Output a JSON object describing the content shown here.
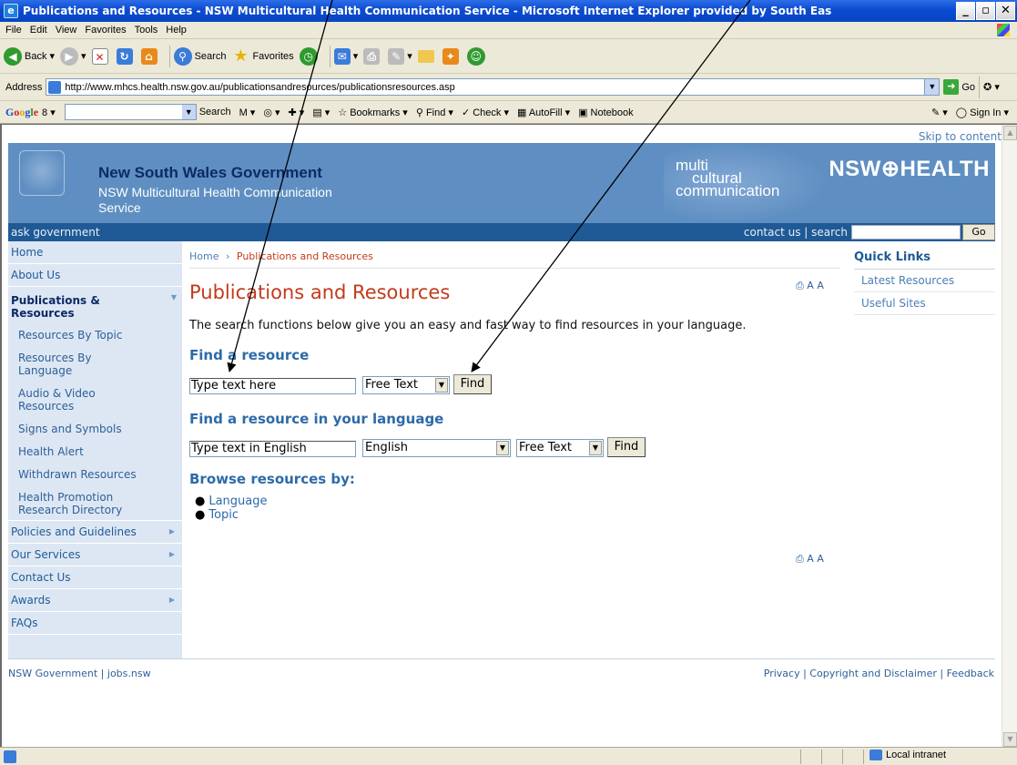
{
  "window": {
    "title": "Publications and Resources - NSW Multicultural Health Communication Service - Microsoft Internet Explorer provided by South Eas",
    "min": "_",
    "max": "▫",
    "close": "✕"
  },
  "menu": [
    "File",
    "Edit",
    "View",
    "Favorites",
    "Tools",
    "Help"
  ],
  "toolbar": {
    "back": "Back",
    "search": "Search",
    "favorites": "Favorites"
  },
  "address": {
    "label": "Address",
    "url": "http://www.mhcs.health.nsw.gov.au/publicationsandresources/publicationsresources.asp",
    "go": "Go"
  },
  "googlebar": {
    "logo": [
      "G",
      "o",
      "o",
      "g",
      "l",
      "e"
    ],
    "search": "Search",
    "bookmarks": "Bookmarks",
    "find": "Find",
    "check": "Check",
    "autofill": "AutoFill",
    "notebook": "Notebook",
    "signin": "Sign In"
  },
  "site": {
    "skip": "Skip to content",
    "gov_name": "New South Wales Government",
    "service_name": "NSW Multicultural Health Communication Service",
    "mcc": [
      "multi",
      "cultural",
      "communication"
    ],
    "nsw_health": "NSW⊕HEALTH",
    "ask": "ask government",
    "top_links": "contact us | search",
    "search_go": "Go"
  },
  "sidebar": {
    "items": [
      {
        "label": "Home",
        "arrow": ""
      },
      {
        "label": "About Us",
        "arrow": ""
      },
      {
        "label": "Publications & Resources",
        "arrow": "▼"
      },
      {
        "label": "Policies and Guidelines",
        "arrow": "▶"
      },
      {
        "label": "Our Services",
        "arrow": "▶"
      },
      {
        "label": "Contact Us",
        "arrow": ""
      },
      {
        "label": "Awards",
        "arrow": "▶"
      },
      {
        "label": "FAQs",
        "arrow": ""
      }
    ],
    "sub": [
      "Resources By Topic",
      "Resources By Language",
      "Audio & Video Resources",
      "Signs and Symbols",
      "Health Alert",
      "Withdrawn Resources",
      "Health Promotion Research Directory"
    ]
  },
  "main": {
    "breadcrumb_home": "Home",
    "breadcrumb_sep": "›",
    "breadcrumb_current": "Publications and Resources",
    "print_text": "⎙ A A",
    "title": "Publications and Resources",
    "intro": "The search functions below give you an easy and fast way to find resources in your language.",
    "find_heading": "Find a resource",
    "find_placeholder": "Type text here",
    "find_type": "Free Text",
    "find_button": "Find",
    "lang_heading": "Find a resource in your language",
    "lang_placeholder": "Type text in English",
    "lang_select": "English",
    "lang_type": "Free Text",
    "lang_button": "Find",
    "browse_heading": "Browse resources by:",
    "browse_items": [
      "Language",
      "Topic"
    ]
  },
  "quick_links": {
    "heading": "Quick Links",
    "items": [
      "Latest Resources",
      "Useful Sites"
    ]
  },
  "footer": {
    "left": "NSW Government | jobs.nsw",
    "right": "Privacy | Copyright and Disclaimer | Feedback"
  },
  "status": {
    "zone": "Local intranet"
  }
}
